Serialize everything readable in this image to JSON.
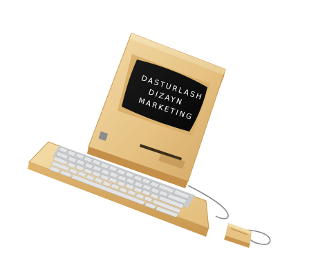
{
  "screen": {
    "lines": [
      "DASTURLASH",
      "DIZAYN",
      "MARKETING"
    ]
  },
  "colors": {
    "background": "#ffffff",
    "case_light": "#efd39c",
    "case_mid": "#e2bd7c",
    "case_dark": "#c99a55",
    "screen": "#0d0d0d",
    "keys": "#d6d8da",
    "cable": "#7a7a7a"
  },
  "icons": [
    "retro-computer",
    "keyboard",
    "mouse",
    "floppy-slot"
  ]
}
